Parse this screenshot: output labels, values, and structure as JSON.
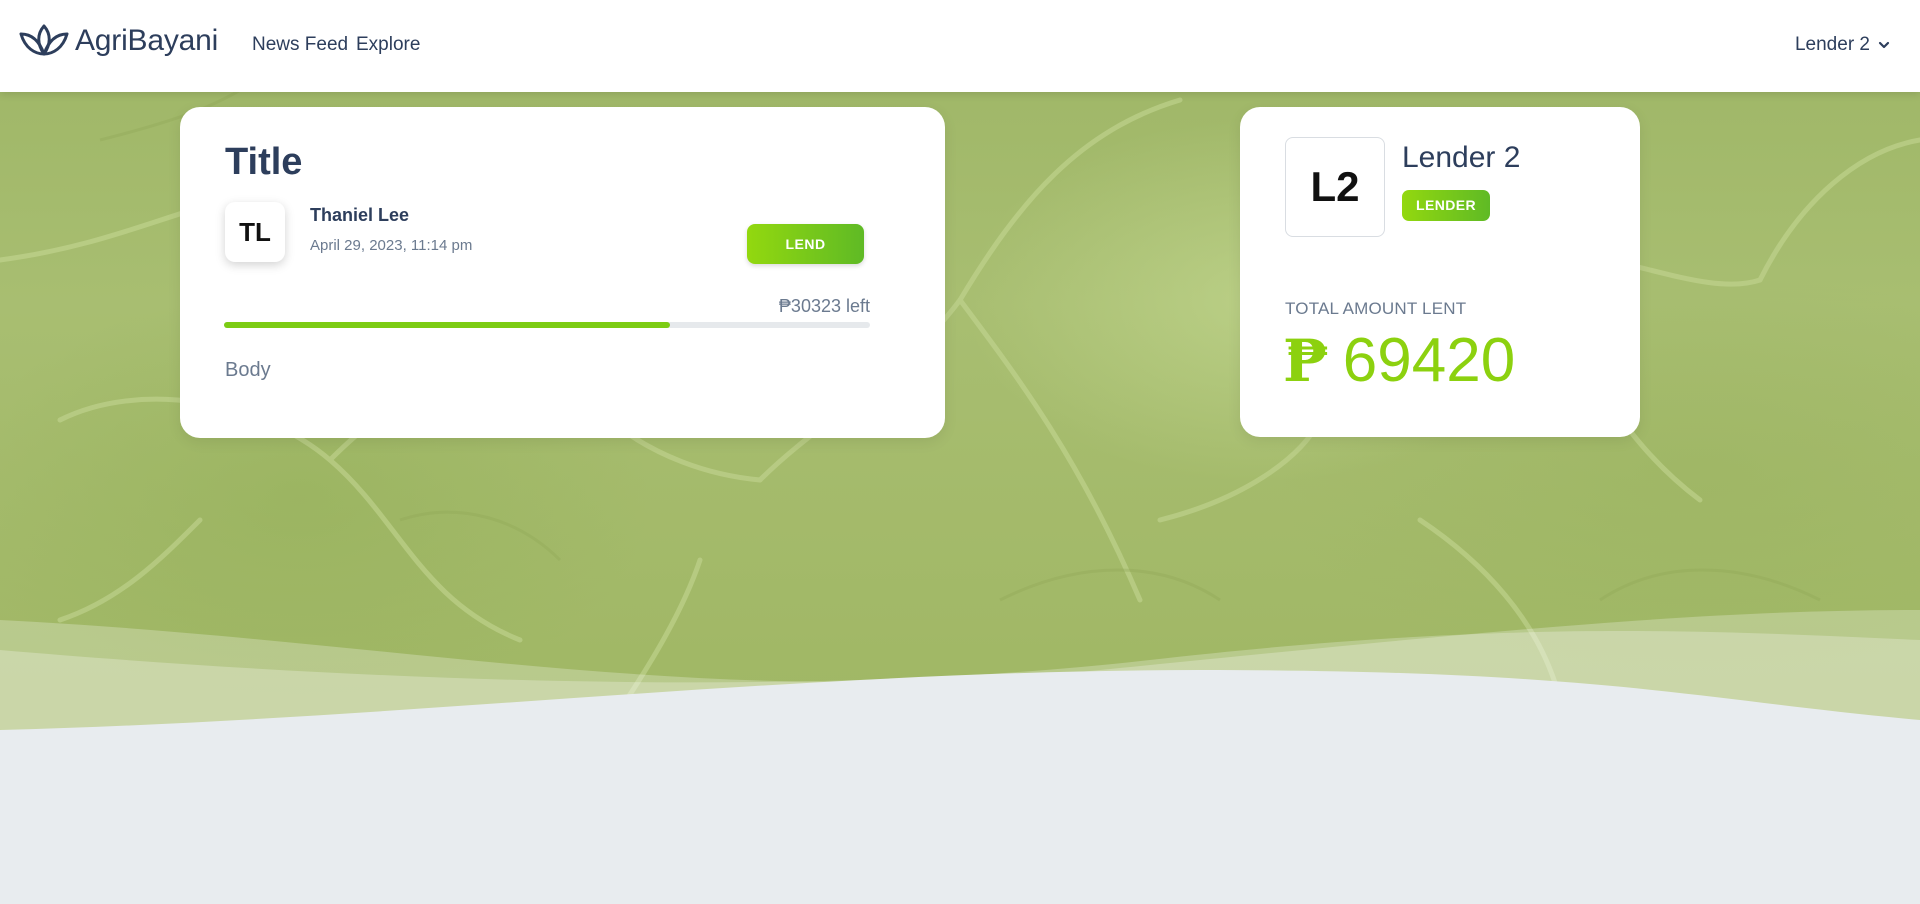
{
  "nav": {
    "brand": "AgriBayani",
    "links": [
      "News Feed",
      "Explore"
    ],
    "user": "Lender 2"
  },
  "post": {
    "title": "Title",
    "author_initials": "TL",
    "author": "Thaniel Lee",
    "date": "April 29, 2023, 11:14 pm",
    "lend_label": "LEND",
    "amount_left": "₱30323 left",
    "progress_fraction": 0.69,
    "body": "Body"
  },
  "profile": {
    "initials": "L2",
    "name": "Lender 2",
    "role": "LENDER",
    "total_label": "TOTAL AMOUNT LENT",
    "currency_symbol": "₱",
    "total_amount": "69420"
  },
  "colors": {
    "accent": "#8cd10f",
    "text": "#2d3e5c",
    "muted": "#6b7a8f"
  }
}
